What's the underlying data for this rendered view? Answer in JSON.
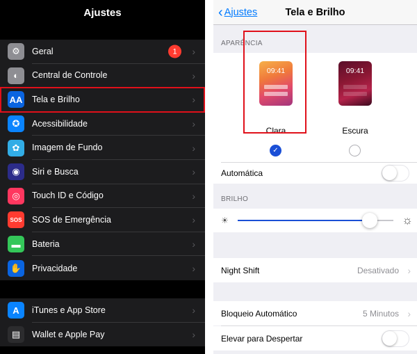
{
  "settings": {
    "title": "Ajustes",
    "group1": [
      {
        "label": "Geral",
        "icon": "gear-icon",
        "color": "#8e8e93",
        "glyph": "⚙",
        "badge": "1"
      },
      {
        "label": "Central de Controle",
        "icon": "toggles-icon",
        "color": "#8e8e93",
        "glyph": "◐"
      },
      {
        "label": "Tela e Brilho",
        "icon": "display-brightness-icon",
        "color": "#0a64e0",
        "glyph": "AA"
      },
      {
        "label": "Acessibilidade",
        "icon": "accessibility-icon",
        "color": "#0a84ff",
        "glyph": "✪"
      },
      {
        "label": "Imagem de Fundo",
        "icon": "wallpaper-icon",
        "color": "#32ade6",
        "glyph": "✿"
      },
      {
        "label": "Siri e Busca",
        "icon": "siri-icon",
        "color": "#2c2c8a",
        "glyph": "◉"
      },
      {
        "label": "Touch ID e Código",
        "icon": "fingerprint-icon",
        "color": "#ff375f",
        "glyph": "◎"
      },
      {
        "label": "SOS de Emergência",
        "icon": "sos-icon",
        "color": "#ff3b30",
        "glyph": "SOS"
      },
      {
        "label": "Bateria",
        "icon": "battery-icon",
        "color": "#34c759",
        "glyph": "▬"
      },
      {
        "label": "Privacidade",
        "icon": "hand-icon",
        "color": "#0a64e0",
        "glyph": "✋"
      }
    ],
    "group2": [
      {
        "label": "iTunes e App Store",
        "icon": "app-store-icon",
        "color": "#0a84ff",
        "glyph": "A"
      },
      {
        "label": "Wallet e Apple Pay",
        "icon": "wallet-icon",
        "color": "#2c2c2e",
        "glyph": "▤"
      }
    ]
  },
  "display": {
    "back_label": "Ajustes",
    "title": "Tela e Brilho",
    "appearance_header": "APARÊNCIA",
    "light_time": "09:41",
    "dark_time": "09:41",
    "light_label": "Clara",
    "dark_label": "Escura",
    "selected": "Clara",
    "automatic_label": "Automática",
    "automatic_on": false,
    "brightness_header": "BRILHO",
    "brightness_level": 0.85,
    "night_shift_label": "Night Shift",
    "night_shift_value": "Desativado",
    "auto_lock_label": "Bloqueio Automático",
    "auto_lock_value": "5 Minutos",
    "raise_to_wake_label": "Elevar para Despertar",
    "raise_to_wake_on": false
  },
  "colors": {
    "accent": "#1a4fd6",
    "ios_blue": "#007aff",
    "highlight_red": "#e0101a",
    "badge_red": "#ff3b30"
  }
}
